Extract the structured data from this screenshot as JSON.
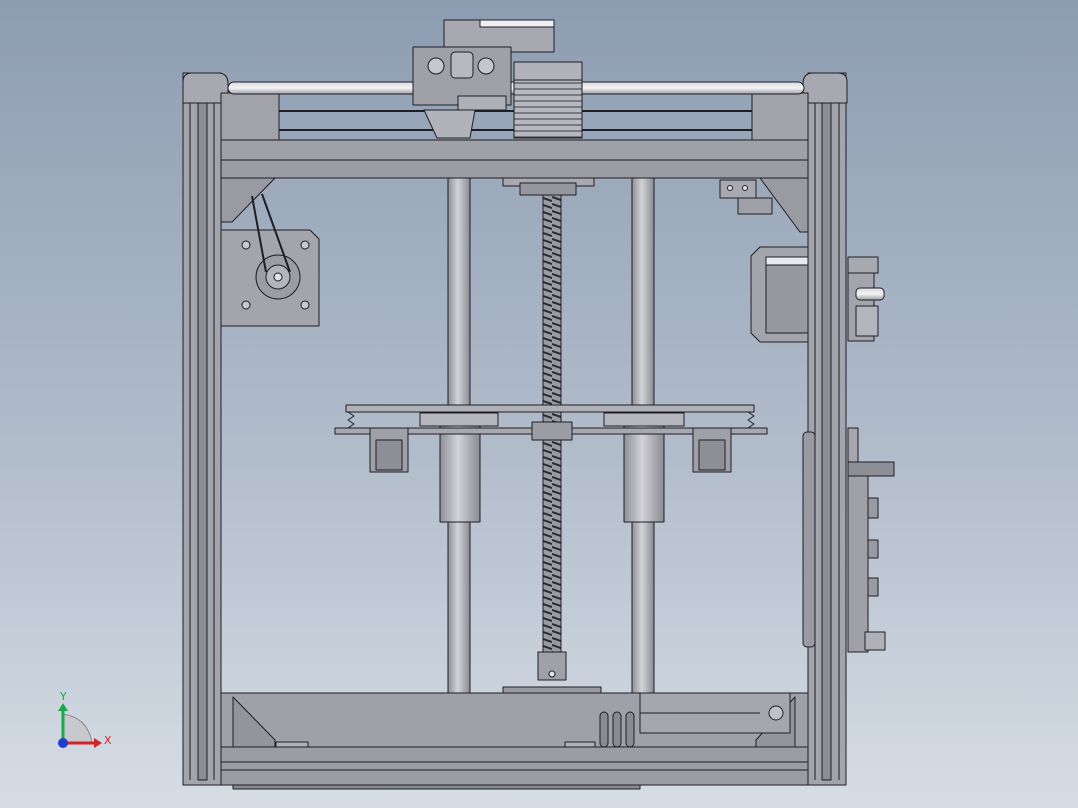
{
  "view": {
    "type": "cad-front-view",
    "subject": "3d-printer-assembly",
    "colors": {
      "background_top": "#8d9db1",
      "background_bottom": "#d6dde5",
      "frame_metal": "#a4a4ac",
      "frame_dark": "#8c8c94",
      "outline": "#1e1e24",
      "rod": "#bfbfc6",
      "leadscrew": "#6e6e74"
    }
  },
  "triad": {
    "x_label": "X",
    "y_label": "Y",
    "x_color": "#d2232a",
    "y_color": "#19a84b",
    "z_color": "#1d3fd0"
  }
}
